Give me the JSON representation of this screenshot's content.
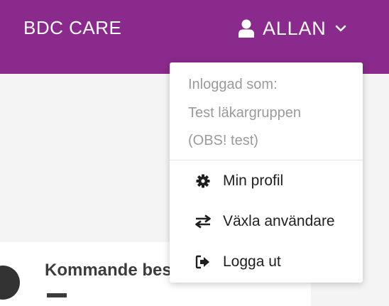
{
  "header": {
    "brand": "BDC CARE",
    "user_name": "ALLAN"
  },
  "card": {
    "title": "Kommande bes"
  },
  "dropdown": {
    "info_lines": [
      "Inloggad som:",
      "Test läkargruppen",
      "(OBS! test)"
    ],
    "items": [
      {
        "label": "Min profil",
        "icon": "gear-icon"
      },
      {
        "label": "Växla användare",
        "icon": "swap-arrows-icon"
      },
      {
        "label": "Logga ut",
        "icon": "logout-icon"
      }
    ]
  },
  "colors": {
    "header_bg": "#8a2a8c",
    "page_bg": "#f4f4f4",
    "muted_text": "#9a9a9a"
  }
}
